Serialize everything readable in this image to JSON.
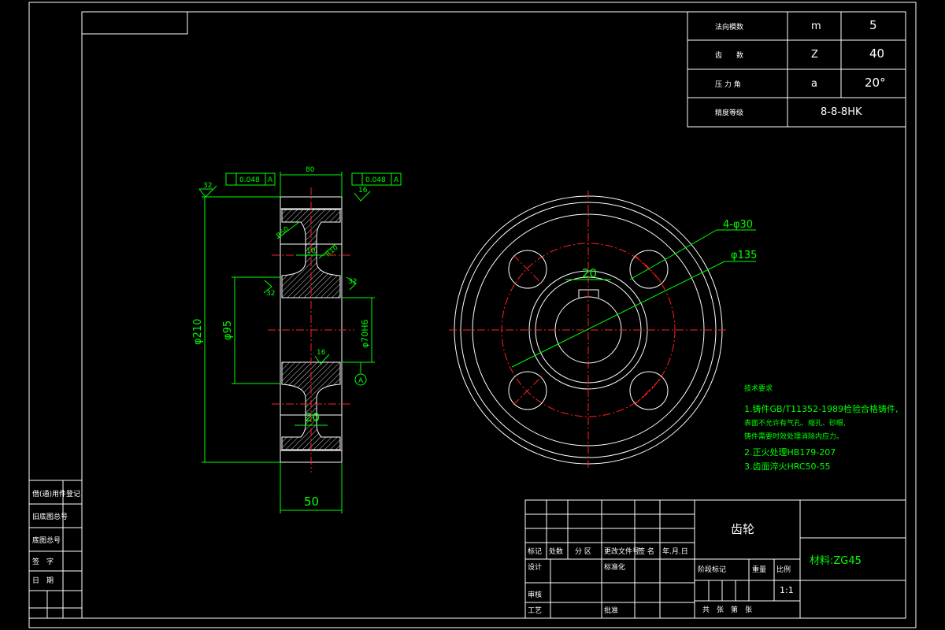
{
  "gear_params": {
    "module": {
      "label": "法向模数",
      "symbol": "m",
      "value": "5"
    },
    "teeth": {
      "label": "齿　　数",
      "symbol": "Z",
      "value": "40"
    },
    "pressure_angle": {
      "label": "压 力 角",
      "symbol": "a",
      "value": "20°"
    },
    "accuracy": {
      "label": "精度等级",
      "value": "8-8-8HK"
    }
  },
  "section_dims": {
    "top_width": "80",
    "tol_left": "0.048",
    "tol_left_ref": "A",
    "tol_right": "0.048",
    "tol_right_ref": "A",
    "rough_32": "32",
    "rough_16_top": "16",
    "rough_16_mid": "16",
    "rough_32_mid": "32",
    "rough_32_right": "32",
    "r50": "R50",
    "r10": "R10",
    "web": "10",
    "dia_210": "φ210",
    "dia_95": "φ95",
    "bore": "φ70H6",
    "datum": "A",
    "rim": "20",
    "bottom_width": "50"
  },
  "front_view": {
    "holes": "4-φ30",
    "pcd": "φ135",
    "keyway": "20"
  },
  "notes": {
    "title": "技术要求",
    "lines": [
      "1.铸件GB/T11352-1989检验合格铸件,",
      "  表面不允许有气孔、缩孔、砂眼,",
      "  铸件需要时效处理消除内应力。",
      "2.正火处理HB179-207",
      "3.齿面淬火HRC50-55"
    ]
  },
  "title_block": {
    "part_name": "齿轮",
    "material": "材料:ZG45",
    "scale": "1:1",
    "row_labels": [
      "标记",
      "处数",
      "分 区",
      "更改文件号",
      "签 名",
      "年.月.日"
    ],
    "designer": "设计",
    "standardize": "标准化",
    "review": "审核",
    "process": "工艺",
    "approve": "批准",
    "stage": "阶段标记",
    "weight": "重量",
    "ratio": "比例",
    "sheets": "共　张　第　张"
  },
  "side_table": [
    "借(通)用件登记",
    "旧底图总号",
    "底图总号",
    "签　字",
    "日　期"
  ]
}
